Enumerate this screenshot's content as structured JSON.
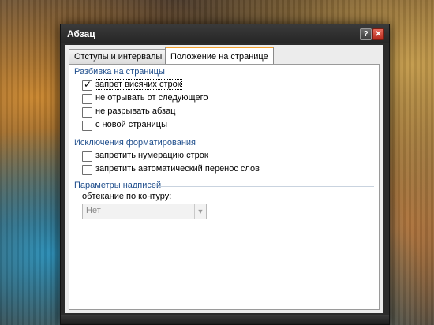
{
  "dialog": {
    "title": "Абзац",
    "help_label": "?",
    "close_label": "✕"
  },
  "tabs": [
    {
      "label": "Отступы и интервалы",
      "active": false
    },
    {
      "label": "Положение на странице",
      "active": true
    }
  ],
  "sections": {
    "pagination": {
      "title": "Разбивка на страницы",
      "options": [
        {
          "label": "запрет висячих строк",
          "checked": true
        },
        {
          "label": "не отрывать от следующего",
          "checked": false
        },
        {
          "label": "не разрывать абзац",
          "checked": false
        },
        {
          "label": "с новой страницы",
          "checked": false
        }
      ]
    },
    "formatting": {
      "title": "Исключения форматирования",
      "options": [
        {
          "label": "запретить нумерацию строк",
          "checked": false
        },
        {
          "label": "запретить автоматический перенос слов",
          "checked": false
        }
      ]
    },
    "textbox": {
      "title": "Параметры надписей",
      "wrap_label": "обтекание по контуру:",
      "wrap_value": "Нет"
    }
  },
  "colors": {
    "section_title": "#1f4e8c",
    "active_tab_accent": "#f4a12a"
  }
}
